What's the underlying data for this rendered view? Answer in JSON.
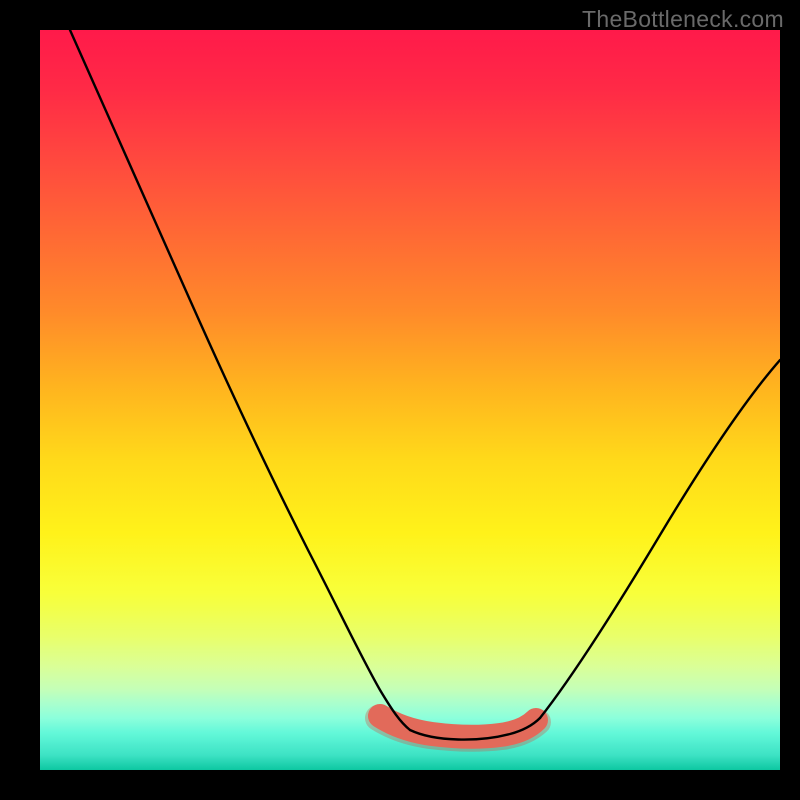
{
  "watermark": "TheBottleneck.com",
  "chart_data": {
    "type": "line",
    "title": "",
    "xlabel": "",
    "ylabel": "",
    "xlim": [
      0,
      100
    ],
    "ylim": [
      0,
      100
    ],
    "background_gradient": {
      "top_color": "#ff1a4a",
      "mid_color": "#ffe01a",
      "bottom_color": "#00c49c"
    },
    "series": [
      {
        "name": "bottleneck-curve",
        "note": "V-shaped curve; y approximates bottleneck severity (100=top/bad red, 0=bottom/good green). Values estimated from pixel positions.",
        "x": [
          4,
          10,
          15,
          20,
          25,
          30,
          35,
          40,
          44,
          48,
          52,
          56,
          60,
          64,
          68,
          74,
          80,
          86,
          92,
          98
        ],
        "y": [
          100,
          88,
          78,
          68,
          58,
          48,
          38,
          28,
          18,
          10,
          5,
          4,
          4,
          5,
          8,
          15,
          24,
          34,
          44,
          54
        ]
      },
      {
        "name": "optimal-range-highlight",
        "note": "Thick coral band marking the low-bottleneck region near the curve minimum.",
        "x": [
          46,
          50,
          54,
          58,
          62,
          66
        ],
        "y": [
          8,
          5,
          4,
          4,
          5,
          7
        ]
      }
    ],
    "colors": {
      "curve": "#000000",
      "highlight": "#e26a5a",
      "frame": "#000000"
    }
  }
}
